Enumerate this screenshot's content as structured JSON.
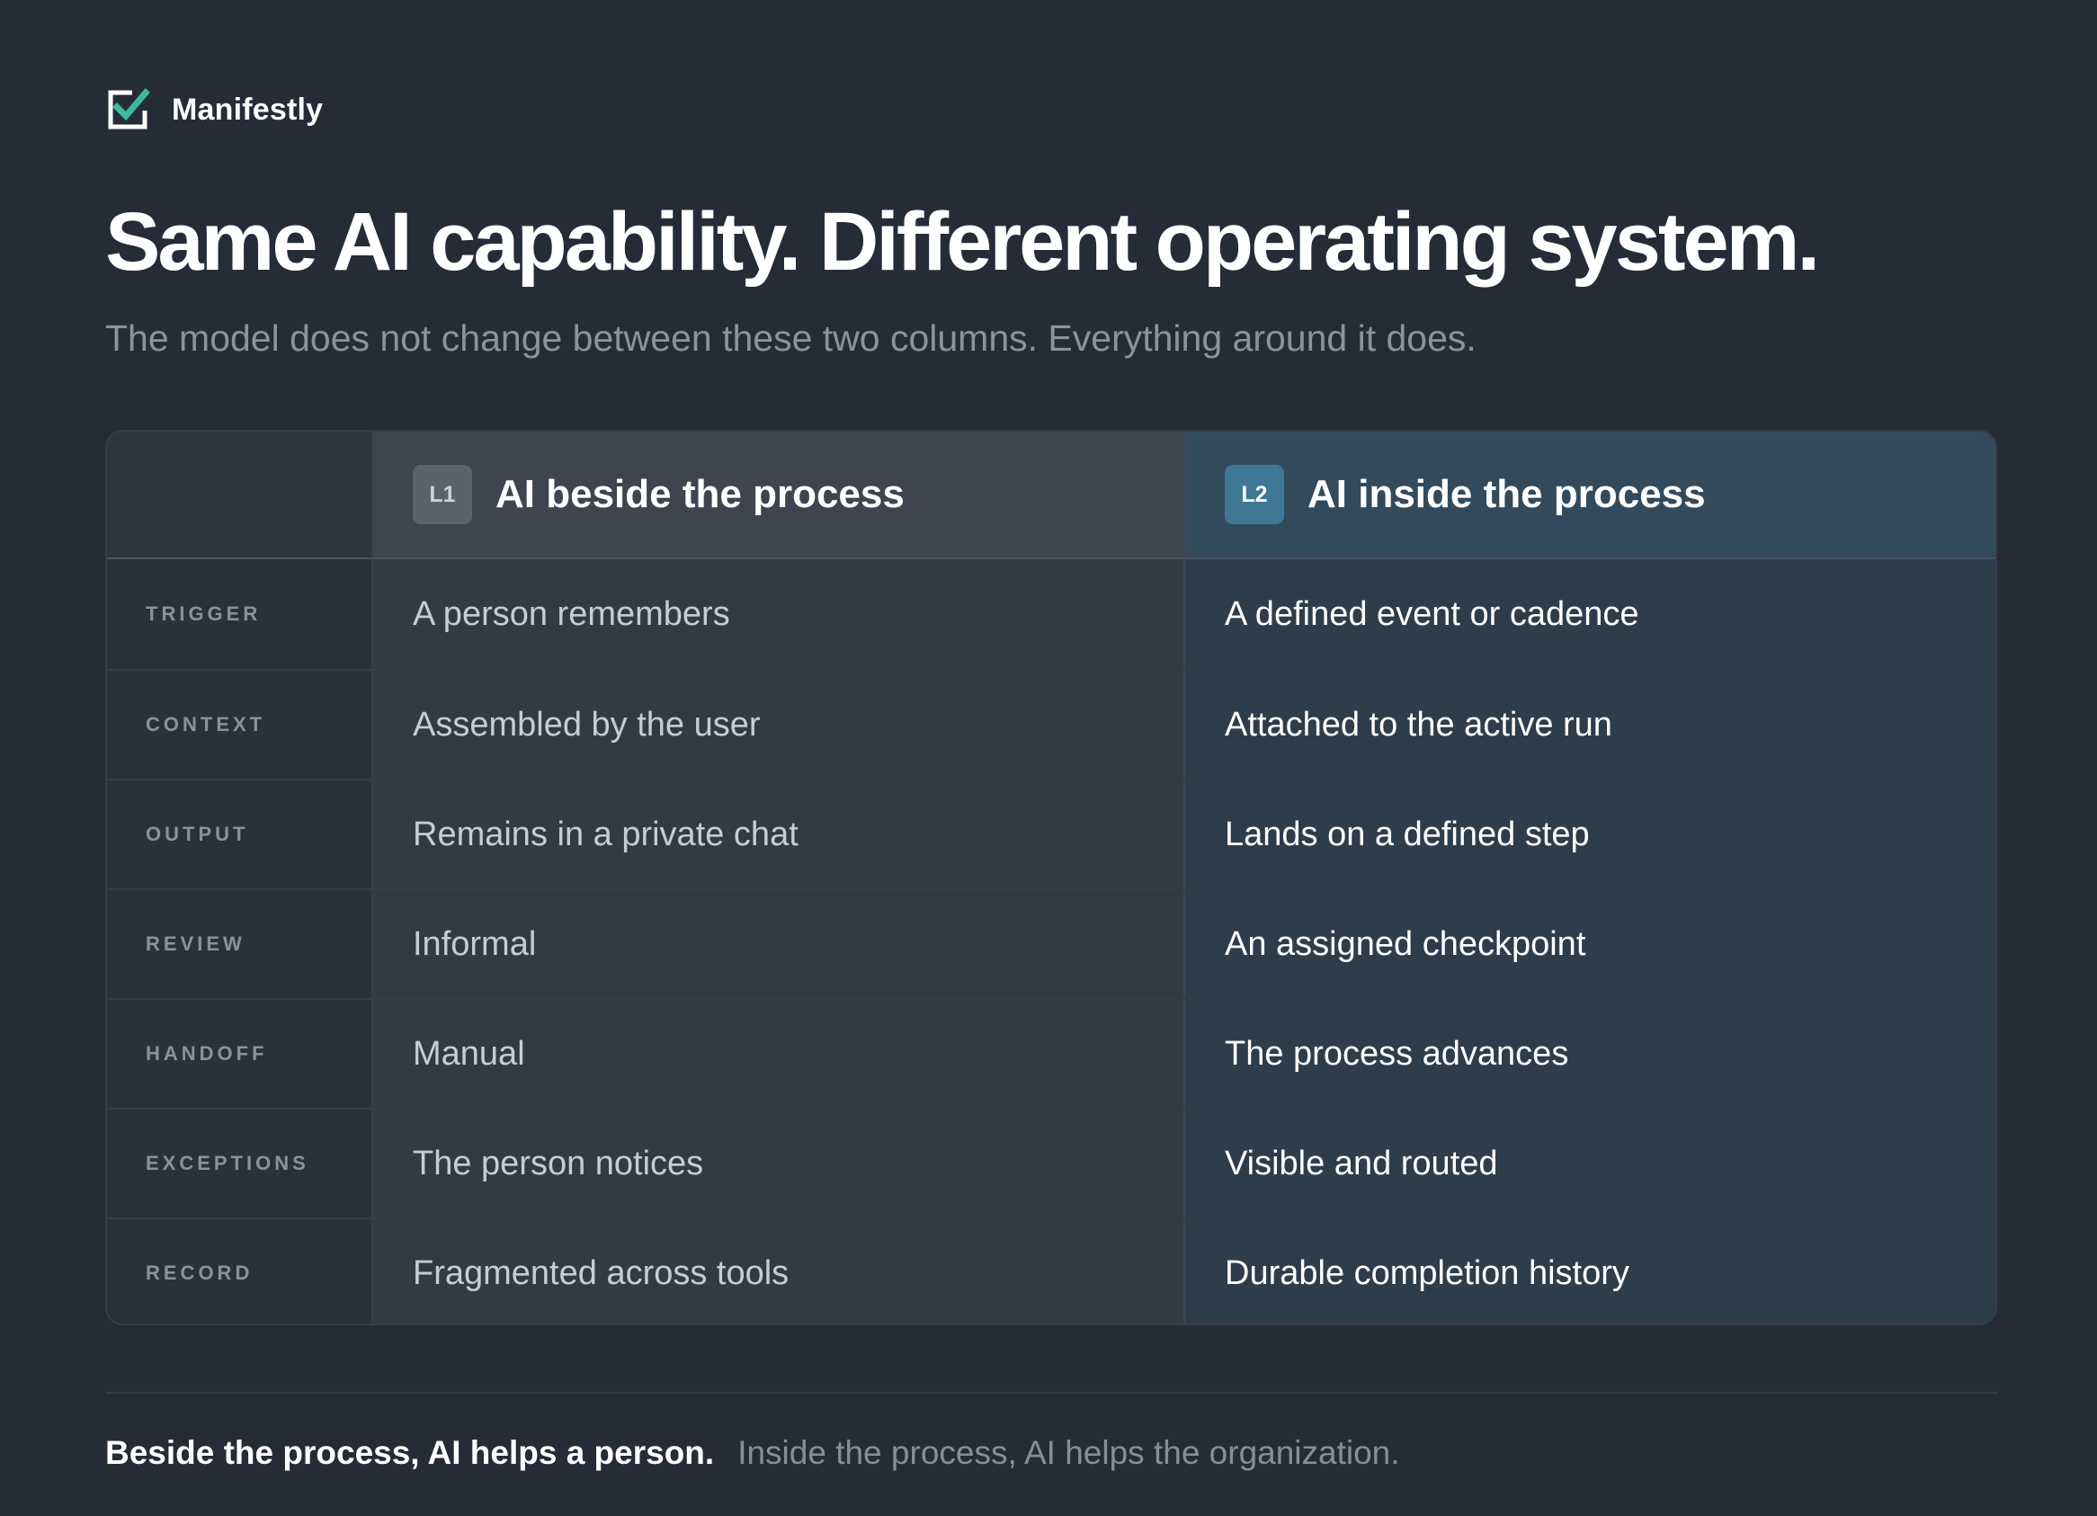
{
  "brand": {
    "name": "Manifestly",
    "icon": "checkbox-check-icon",
    "accent": "#3fb8a0"
  },
  "heading": {
    "title": "Same AI capability. Different operating system.",
    "subtitle": "The model does not change between these two columns. Everything around it does."
  },
  "table": {
    "columns": [
      {
        "badge": "L1",
        "title": "AI beside the process"
      },
      {
        "badge": "L2",
        "title": "AI inside the process"
      }
    ],
    "rows": [
      {
        "label": "TRIGGER",
        "l1": "A person remembers",
        "l2": "A defined event or cadence"
      },
      {
        "label": "CONTEXT",
        "l1": "Assembled by the user",
        "l2": "Attached to the active run"
      },
      {
        "label": "OUTPUT",
        "l1": "Remains in a private chat",
        "l2": "Lands on a defined step"
      },
      {
        "label": "REVIEW",
        "l1": "Informal",
        "l2": "An assigned checkpoint"
      },
      {
        "label": "HANDOFF",
        "l1": "Manual",
        "l2": "The process advances"
      },
      {
        "label": "EXCEPTIONS",
        "l1": "The person notices",
        "l2": "Visible and routed"
      },
      {
        "label": "RECORD",
        "l1": "Fragmented across tools",
        "l2": "Durable completion history"
      }
    ]
  },
  "footer": {
    "strong": "Beside the process, AI helps a person.",
    "muted": "Inside the process, AI helps the organization."
  }
}
